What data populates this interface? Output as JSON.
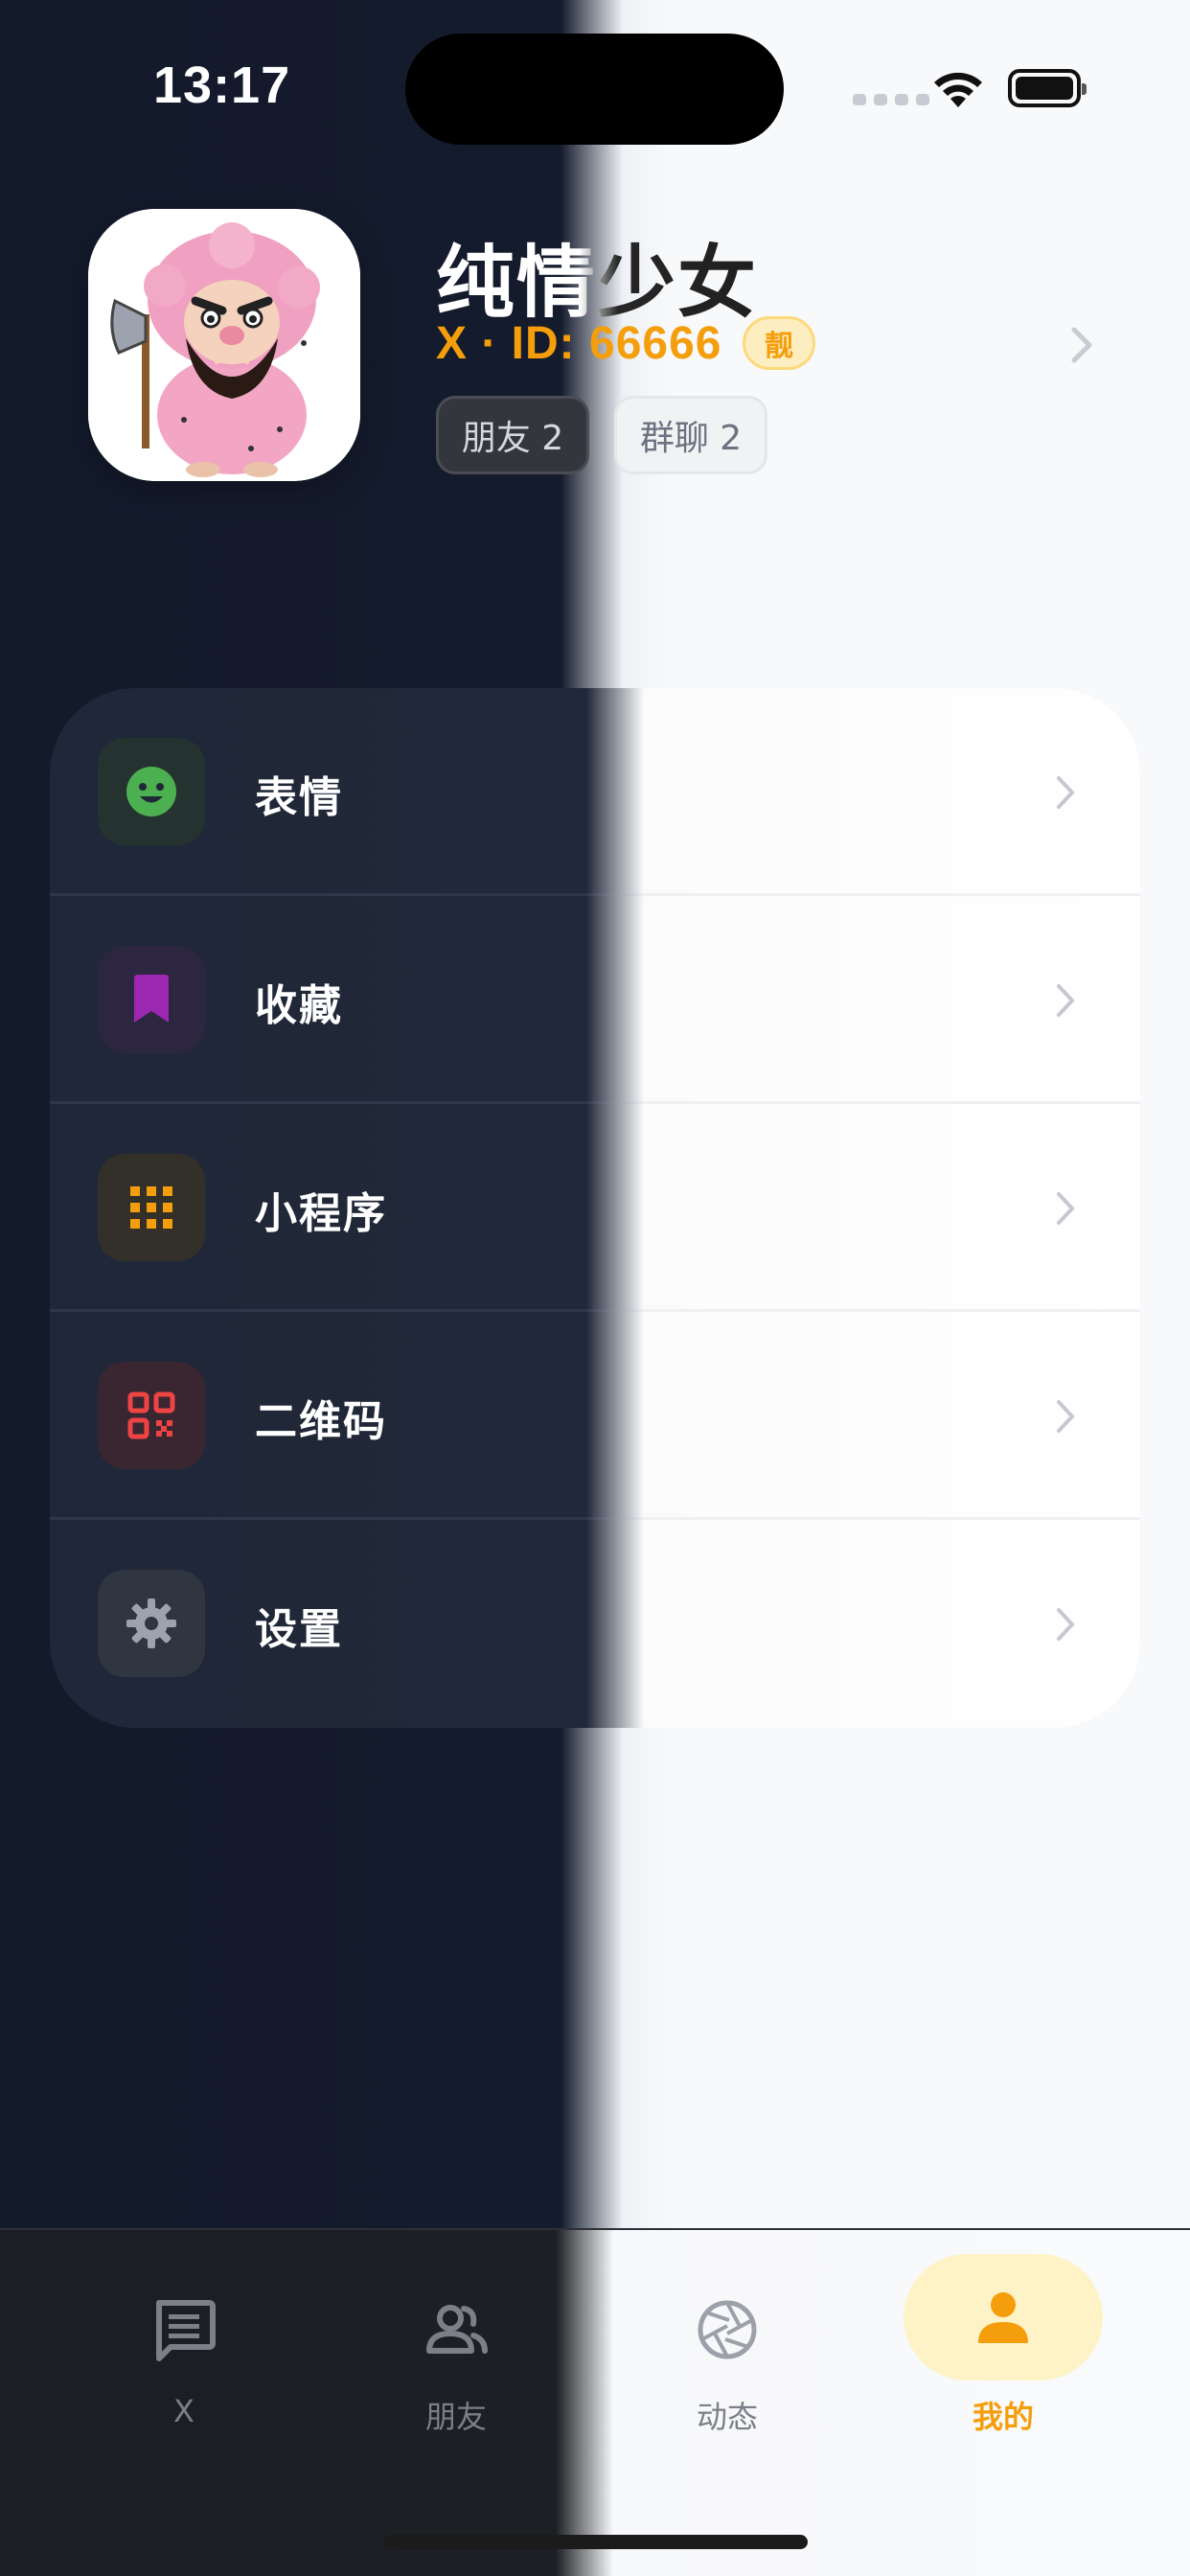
{
  "status_bar": {
    "time": "13:17"
  },
  "profile": {
    "name": "纯情少女",
    "id_text": "X · ID: 66666",
    "badge": "靓",
    "chips": [
      {
        "label": "朋友 2"
      },
      {
        "label": "群聊 2"
      }
    ]
  },
  "menu": {
    "items": [
      {
        "label": "表情",
        "icon": "smile-icon",
        "color": "#4caf50"
      },
      {
        "label": "收藏",
        "icon": "bookmark-icon",
        "color": "#9c27b0"
      },
      {
        "label": "小程序",
        "icon": "apps-grid-icon",
        "color": "#f59e0b"
      },
      {
        "label": "二维码",
        "icon": "qr-code-icon",
        "color": "#ef4444"
      },
      {
        "label": "设置",
        "icon": "gear-icon",
        "color": "#9ca3af"
      }
    ]
  },
  "tabbar": {
    "tabs": [
      {
        "label": "X",
        "icon": "chat-icon"
      },
      {
        "label": "朋友",
        "icon": "friends-icon"
      },
      {
        "label": "动态",
        "icon": "aperture-icon"
      },
      {
        "label": "我的",
        "icon": "person-icon",
        "active": true
      }
    ],
    "active_color": "#f59e0b",
    "inactive_color": "#7b7f87"
  }
}
